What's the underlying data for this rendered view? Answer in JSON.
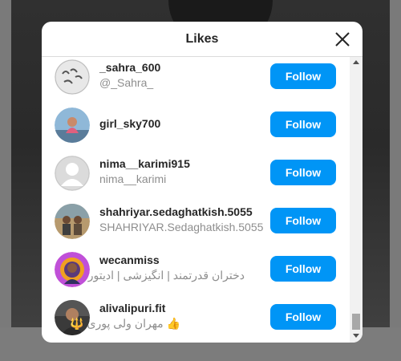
{
  "modal": {
    "title": "Likes",
    "close_icon": "close-icon"
  },
  "likes": [
    {
      "username": "_sahra_600",
      "full_name": "@_Sahra_",
      "button": "Follow"
    },
    {
      "username": "girl_sky700",
      "full_name": "",
      "button": "Follow"
    },
    {
      "username": "nima__karimi915",
      "full_name": "nima__karimi",
      "button": "Follow"
    },
    {
      "username": "shahriyar.sedaghatkish.5055",
      "full_name": "SHAHRIYAR.Sedaghatkish.5055",
      "button": "Follow"
    },
    {
      "username": "wecanmiss",
      "full_name": "دختران قدرتمند | انگیزشی | ادیتور",
      "button": "Follow"
    },
    {
      "username": "alivalipuri.fit",
      "full_name": "👍 مهران ولی پوری 🔱",
      "button": "Follow"
    }
  ],
  "colors": {
    "follow_button": "#0095f6",
    "username": "#262626",
    "full_name": "#8e8e8e"
  }
}
